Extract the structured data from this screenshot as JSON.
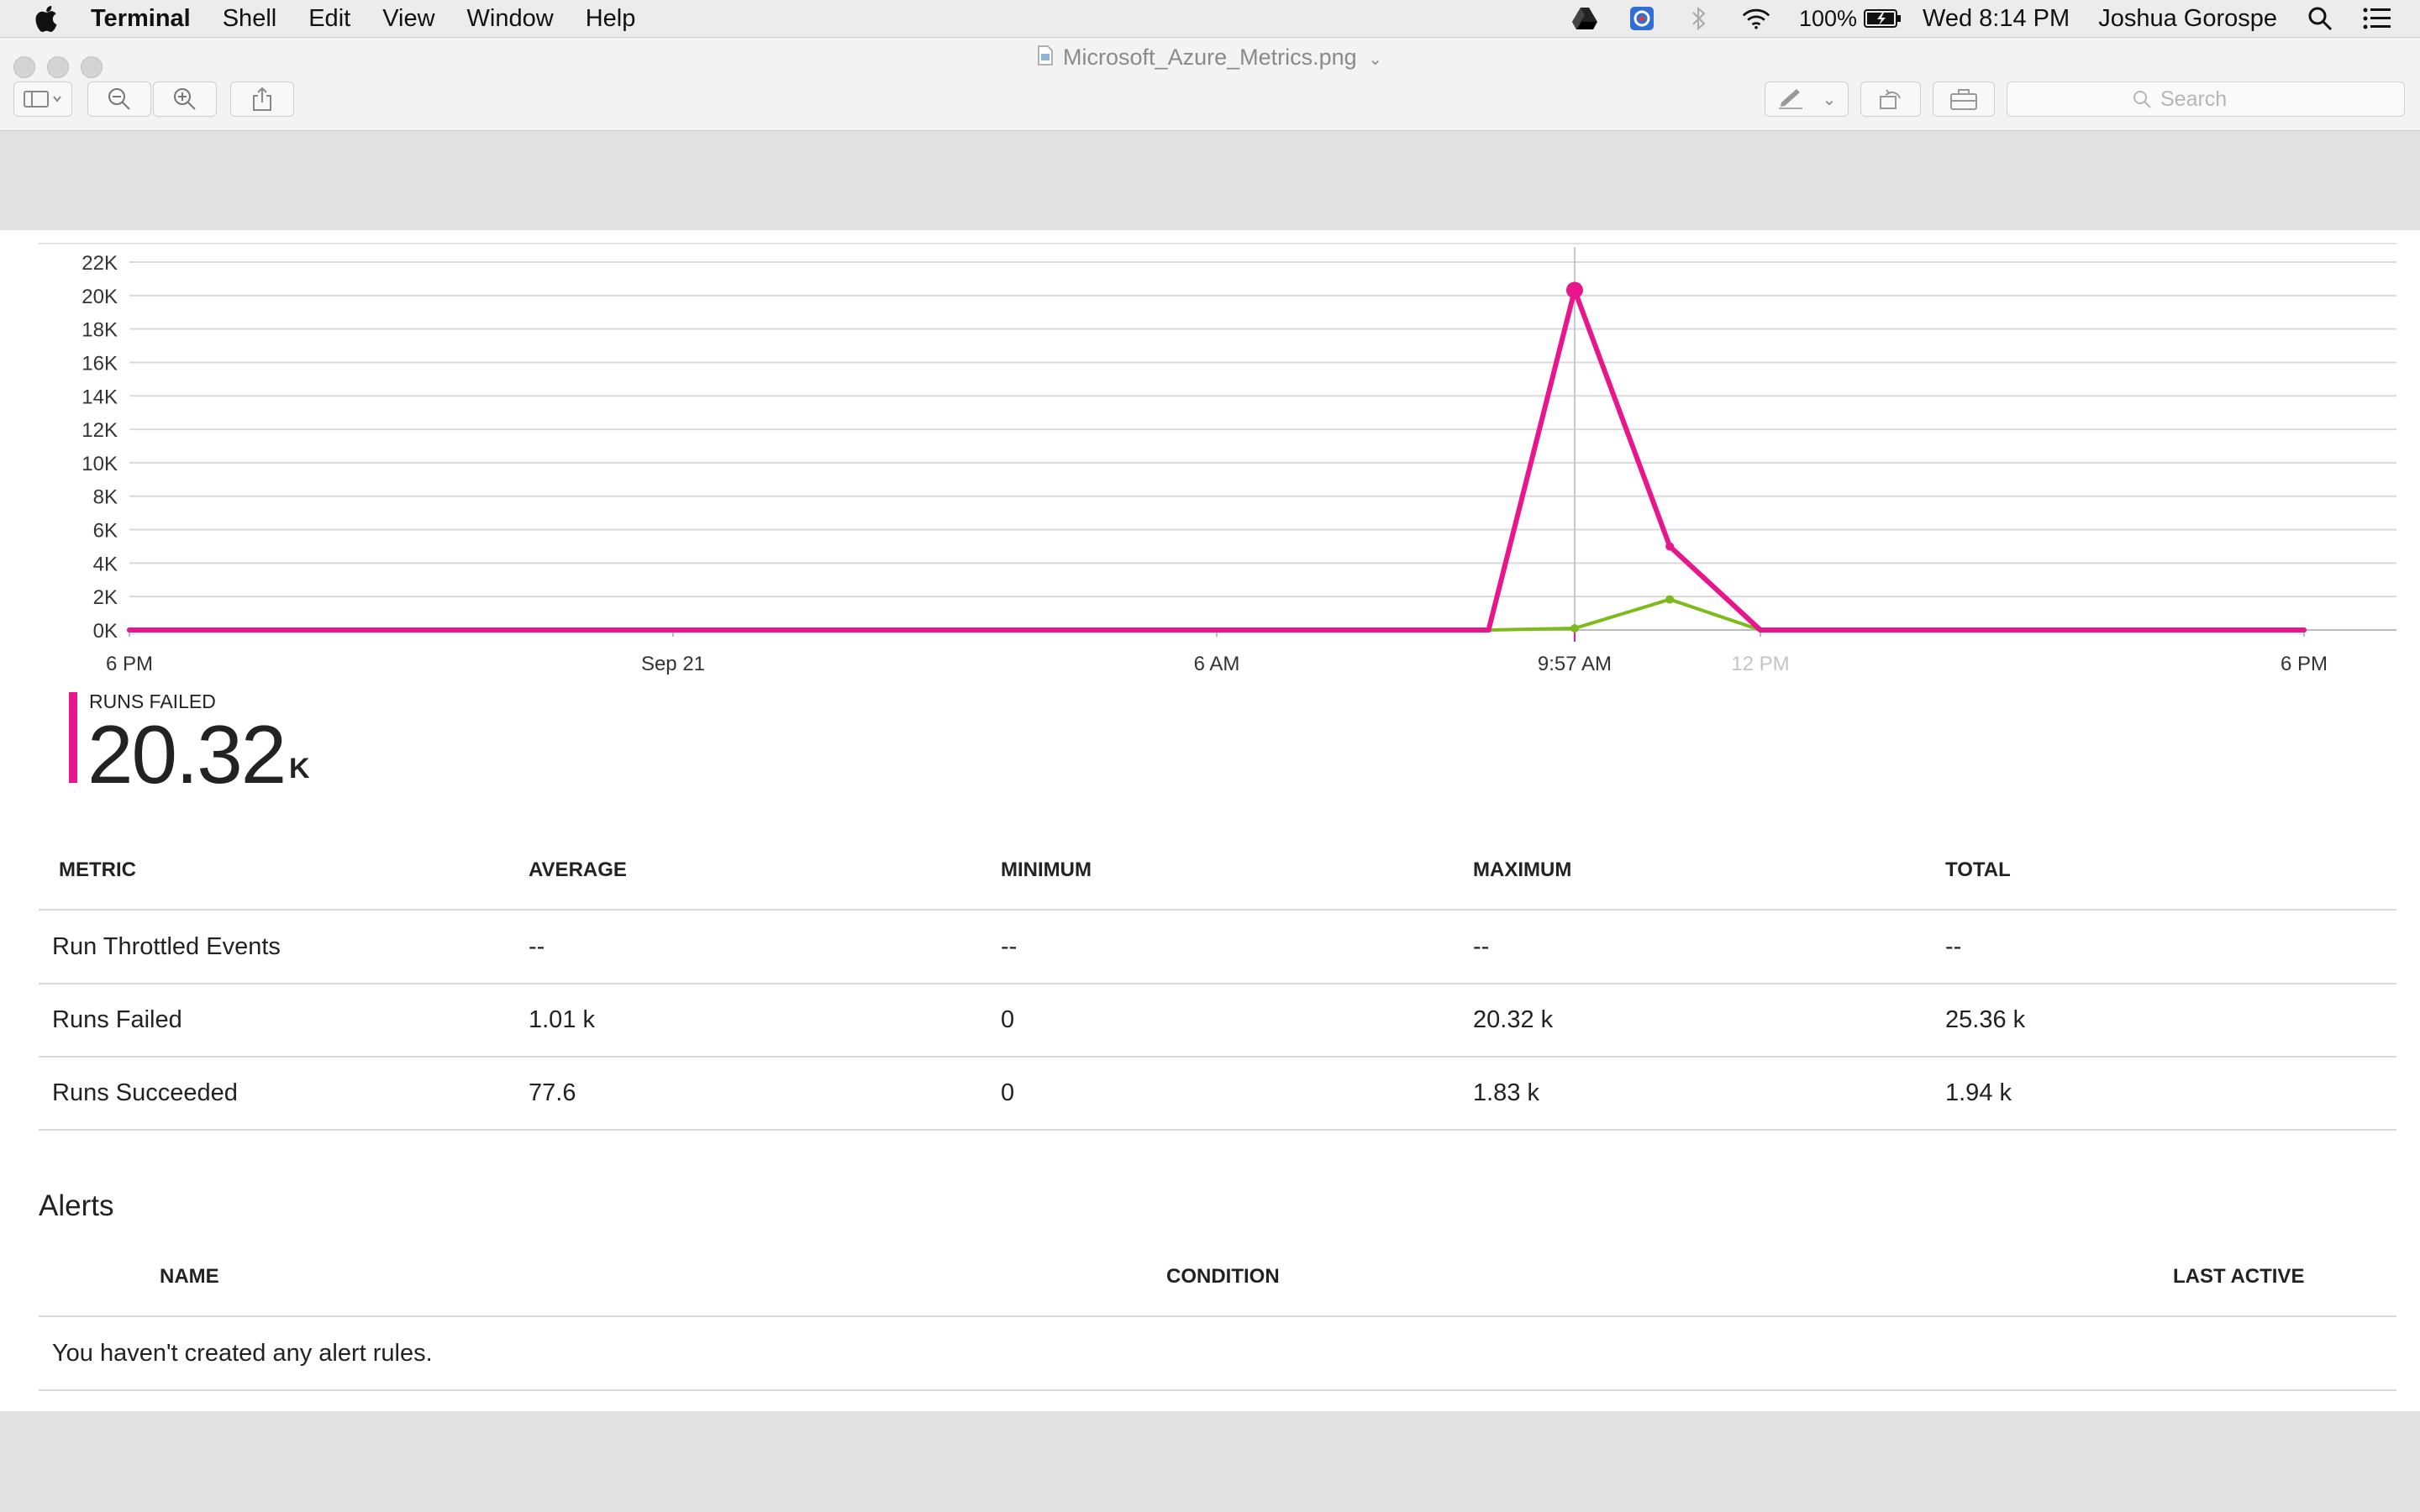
{
  "menubar": {
    "app_name": "Terminal",
    "menus": [
      "Shell",
      "Edit",
      "View",
      "Window",
      "Help"
    ],
    "battery": "100%",
    "clock": "Wed 8:14 PM",
    "user": "Joshua Gorospe"
  },
  "window": {
    "title": "Microsoft_Azure_Metrics.png",
    "search_placeholder": "Search"
  },
  "chart_data": {
    "type": "line",
    "x_tick_labels": [
      "6 PM",
      "Sep 21",
      "6 AM",
      "9:57 AM",
      "12 PM",
      "6 PM"
    ],
    "highlight_x_label": "9:57 AM",
    "dimmed_x_label": "12 PM",
    "y_tick_labels": [
      "0K",
      "2K",
      "4K",
      "6K",
      "8K",
      "10K",
      "12K",
      "14K",
      "16K",
      "18K",
      "20K",
      "22K"
    ],
    "ylim": [
      0,
      23000
    ],
    "x_hours_from_6pm": [
      0,
      1,
      2,
      3,
      4,
      5,
      6,
      7,
      8,
      9,
      10,
      11,
      12,
      13,
      14,
      15,
      15.95,
      17,
      18,
      19,
      20,
      21,
      22,
      23,
      24
    ],
    "series": [
      {
        "name": "Runs Failed",
        "color": "#e8168c",
        "values": [
          0,
          0,
          0,
          0,
          0,
          0,
          0,
          0,
          0,
          0,
          0,
          0,
          0,
          0,
          0,
          0,
          20320,
          5000,
          0,
          0,
          0,
          0,
          0,
          0,
          0
        ]
      },
      {
        "name": "Runs Succeeded",
        "color": "#7dbb1a",
        "values": [
          0,
          0,
          0,
          0,
          0,
          0,
          0,
          0,
          0,
          0,
          0,
          0,
          0,
          0,
          0,
          0,
          100,
          1830,
          0,
          0,
          0,
          0,
          0,
          0,
          0
        ]
      }
    ],
    "grid": true
  },
  "summary": {
    "label": "RUNS FAILED",
    "value": "20.32",
    "unit": "K",
    "accent": "#e8168c"
  },
  "metrics_table": {
    "headers": [
      "METRIC",
      "AVERAGE",
      "MINIMUM",
      "MAXIMUM",
      "TOTAL"
    ],
    "rows": [
      [
        "Run Throttled Events",
        "--",
        "--",
        "--",
        "--"
      ],
      [
        "Runs Failed",
        "1.01 k",
        "0",
        "20.32 k",
        "25.36 k"
      ],
      [
        "Runs Succeeded",
        "77.6",
        "0",
        "1.83 k",
        "1.94 k"
      ]
    ]
  },
  "alerts": {
    "title": "Alerts",
    "headers": [
      "NAME",
      "CONDITION",
      "LAST ACTIVE"
    ],
    "empty_message": "You haven't created any alert rules."
  }
}
